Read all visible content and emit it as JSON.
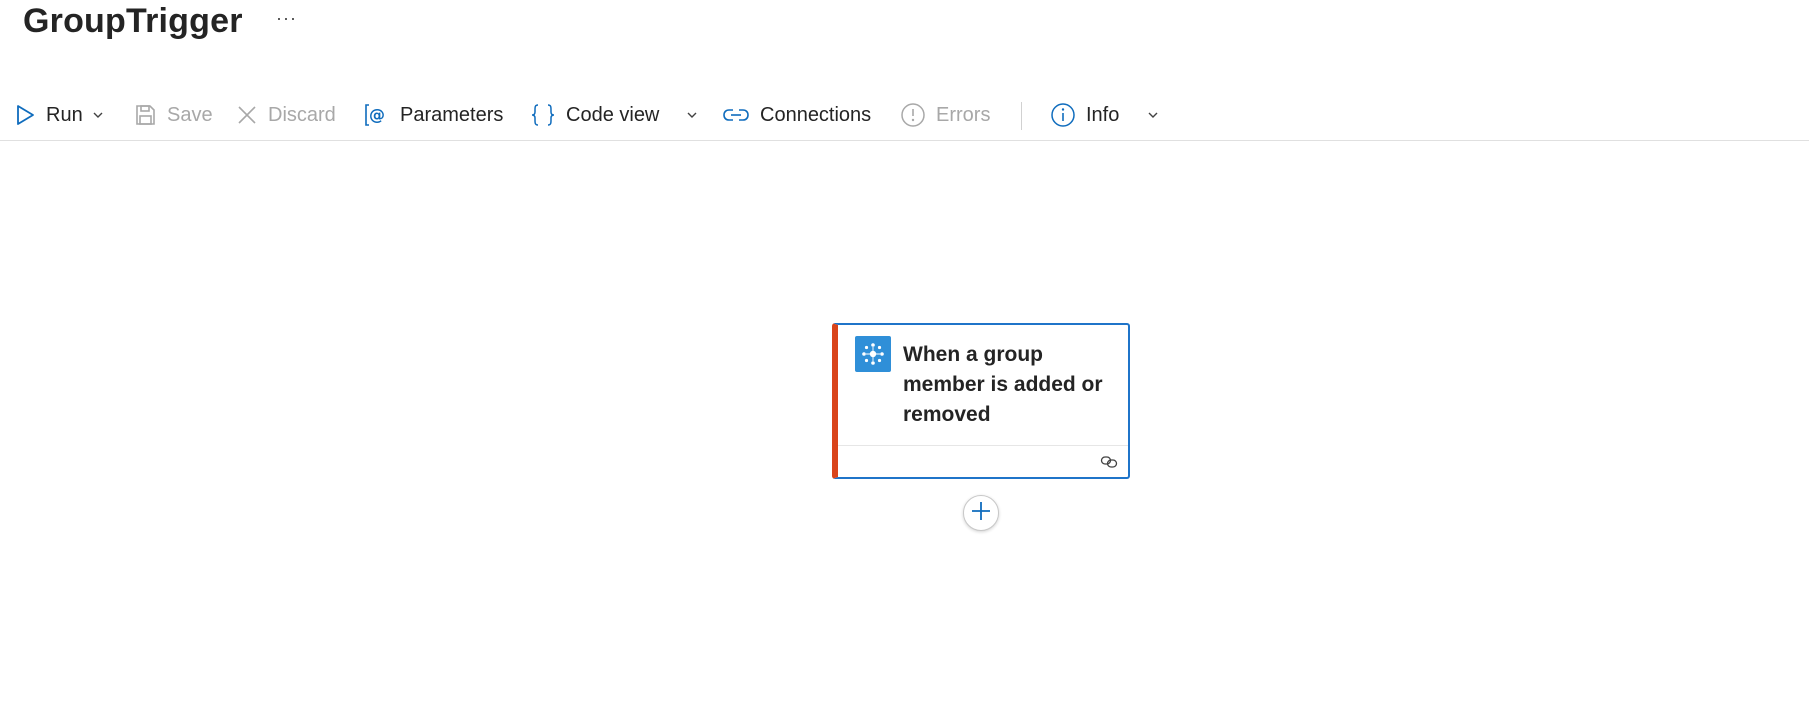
{
  "header": {
    "title": "GroupTrigger",
    "more_label": "···"
  },
  "toolbar": {
    "run_label": "Run",
    "save_label": "Save",
    "discard_label": "Discard",
    "parameters_label": "Parameters",
    "code_view_label": "Code view",
    "connections_label": "Connections",
    "errors_label": "Errors",
    "info_label": "Info"
  },
  "canvas": {
    "trigger": {
      "title": "When a group member is added or removed",
      "icon": "office-groups-icon",
      "accent_color": "#d9441b",
      "border_color": "#1f74c9",
      "footer_icon": "connection-link-icon"
    },
    "add_step_icon": "plus-icon"
  },
  "colors": {
    "brand": "#0f6cbd",
    "disabled": "#a8a8a8"
  }
}
